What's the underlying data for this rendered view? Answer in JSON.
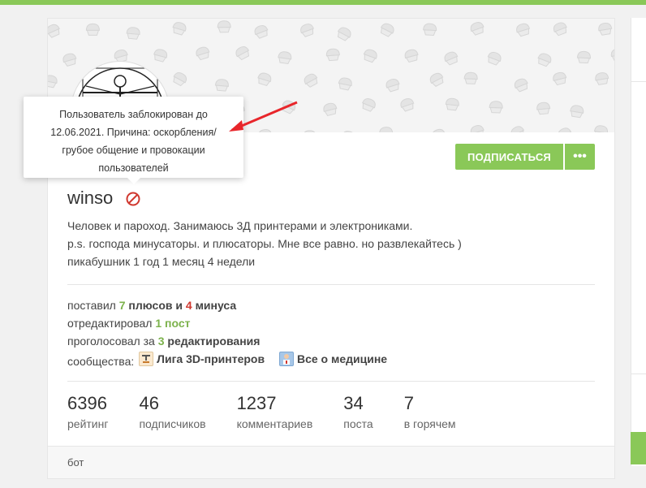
{
  "tooltip": {
    "text": "Пользователь заблокирован до 12.06.2021. Причина: оскорбления/грубое общение и провокации пользователей"
  },
  "profile": {
    "username": "winso",
    "bio_lines": [
      "Человек и пароход. Занимаюсь 3Д принтерами и электрониками.",
      "p.s. господа минусаторы. и плюсаторы. Мне все равно. но развлекайтесь )",
      "пикабушник 1 год 1 месяц 4 недели"
    ]
  },
  "buttons": {
    "subscribe": "ПОДПИСАТЬСЯ",
    "more": "•••"
  },
  "activity": {
    "placed_prefix": "поставил",
    "plus_count": "7",
    "plus_word": "плюсов",
    "and": "и",
    "minus_count": "4",
    "minus_word": "минуса",
    "edited_prefix": "отредактировал",
    "edited_count": "1 пост",
    "voted_prefix": "проголосовал за",
    "voted_count": "3",
    "voted_word": "редактирования",
    "communities_label": "сообщества:",
    "communities": [
      {
        "name": "Лига 3D-принтеров",
        "icon": "printer-3d-icon"
      },
      {
        "name": "Все о медицине",
        "icon": "medicine-icon"
      }
    ]
  },
  "counters": [
    {
      "value": "6396",
      "label": "рейтинг"
    },
    {
      "value": "46",
      "label": "подписчиков"
    },
    {
      "value": "1237",
      "label": "комментариев"
    },
    {
      "value": "34",
      "label": "поста"
    },
    {
      "value": "7",
      "label": "в горячем"
    }
  ],
  "footer": {
    "note": "бот"
  },
  "colors": {
    "accent": "#8ac858",
    "plus": "#7cb24c",
    "minus": "#d0382f",
    "annotation_arrow": "#e8262b"
  }
}
